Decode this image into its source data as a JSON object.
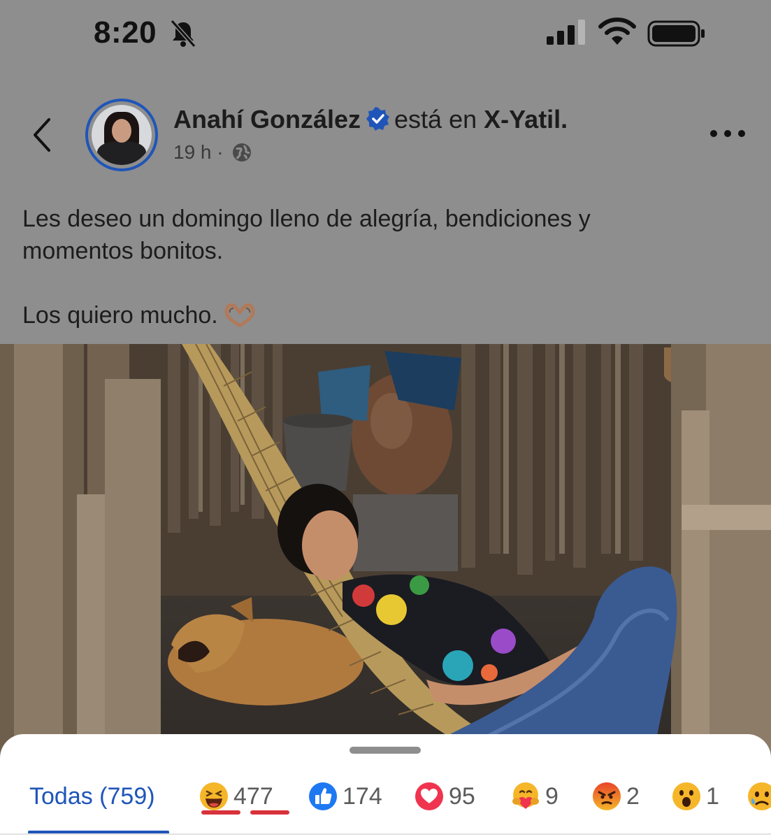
{
  "status_bar": {
    "time": "8:20",
    "icons": [
      "bell-slash-icon",
      "cellular-signal-icon",
      "wifi-icon",
      "battery-icon"
    ]
  },
  "post": {
    "author": "Anahí González",
    "verified": true,
    "location_prefix": "está en",
    "location": "X-Yatil.",
    "time_ago": "19 h",
    "separator": "·",
    "audience_icon": "globe-icon",
    "caption_lines": [
      "Les deseo un domingo lleno de alegría, bendiciones y",
      "momentos bonitos."
    ],
    "caption_closing": "Los quiero mucho."
  },
  "reactions": {
    "all_label": "Todas (759)",
    "items": [
      {
        "type": "haha",
        "count": "477"
      },
      {
        "type": "like",
        "count": "174"
      },
      {
        "type": "love",
        "count": "95"
      },
      {
        "type": "care",
        "count": "9"
      },
      {
        "type": "angry",
        "count": "2"
      },
      {
        "type": "wow",
        "count": "1"
      },
      {
        "type": "sad",
        "count": ""
      }
    ]
  },
  "colors": {
    "accent": "#1f55b8",
    "overlay": "#8e8e8e",
    "annotation_red": "#d8323c"
  }
}
